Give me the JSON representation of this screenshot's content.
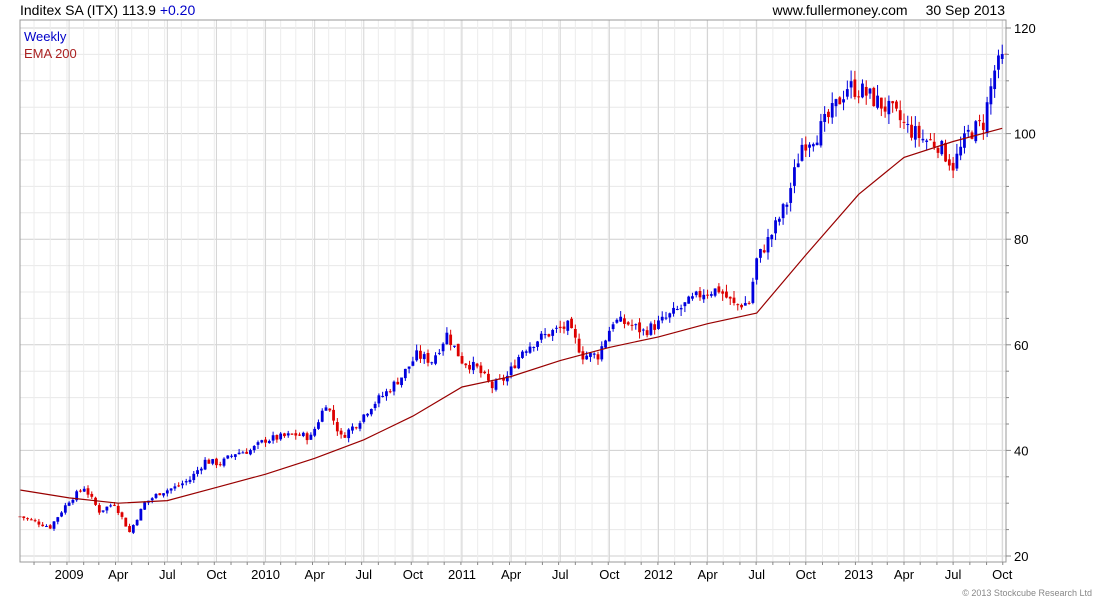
{
  "header": {
    "company": "Inditex SA (ITX)",
    "price": "113.9",
    "change": "+0.20",
    "website": "www.fullermoney.com",
    "date": "30 Sep 2013"
  },
  "footer": {
    "copyright": "© 2013 Stockcube Research Ltd"
  },
  "colors": {
    "up": "#0000dd",
    "down": "#dd0000",
    "ema": "#990000",
    "grid": "#dddddd",
    "frame": "#999999"
  },
  "chart_data": {
    "type": "line",
    "subtype": "candlestick-weekly",
    "title": "Inditex SA (ITX)",
    "xlabel": "",
    "ylabel": "",
    "ylim": [
      20,
      120
    ],
    "y_ticks": [
      20,
      40,
      60,
      80,
      100,
      120
    ],
    "y_axis_side": "right",
    "x_range": [
      "2008-10-06",
      "2013-10-07"
    ],
    "x_ticks": [
      {
        "label": "2009",
        "date": "2009-01-05"
      },
      {
        "label": "Apr",
        "date": "2009-04-06"
      },
      {
        "label": "Jul",
        "date": "2009-07-06"
      },
      {
        "label": "Oct",
        "date": "2009-10-05"
      },
      {
        "label": "2010",
        "date": "2010-01-04"
      },
      {
        "label": "Apr",
        "date": "2010-04-05"
      },
      {
        "label": "Jul",
        "date": "2010-07-05"
      },
      {
        "label": "Oct",
        "date": "2010-10-04"
      },
      {
        "label": "2011",
        "date": "2011-01-03"
      },
      {
        "label": "Apr",
        "date": "2011-04-04"
      },
      {
        "label": "Jul",
        "date": "2011-07-04"
      },
      {
        "label": "Oct",
        "date": "2011-10-03"
      },
      {
        "label": "2012",
        "date": "2012-01-02"
      },
      {
        "label": "Apr",
        "date": "2012-04-02"
      },
      {
        "label": "Jul",
        "date": "2012-07-02"
      },
      {
        "label": "Oct",
        "date": "2012-10-01"
      },
      {
        "label": "2013",
        "date": "2013-01-07"
      },
      {
        "label": "Apr",
        "date": "2013-04-01"
      },
      {
        "label": "Jul",
        "date": "2013-07-01"
      },
      {
        "label": "Oct",
        "date": "2013-09-30"
      }
    ],
    "grid": true,
    "legend": {
      "position": "top-left",
      "entries": [
        "Weekly",
        "EMA 200"
      ]
    },
    "series": [
      {
        "name": "Weekly",
        "kind": "candlestick",
        "approx_weekly_close": [
          [
            "2008-10-06",
            27.5
          ],
          [
            "2008-12-01",
            25.5
          ],
          [
            "2009-01-05",
            30.5
          ],
          [
            "2009-02-02",
            33.0
          ],
          [
            "2009-03-02",
            28.5
          ],
          [
            "2009-03-30",
            30.0
          ],
          [
            "2009-04-27",
            24.5
          ],
          [
            "2009-05-25",
            30.0
          ],
          [
            "2009-06-22",
            32.0
          ],
          [
            "2009-07-20",
            33.0
          ],
          [
            "2009-08-17",
            34.5
          ],
          [
            "2009-09-14",
            38.0
          ],
          [
            "2009-10-12",
            37.5
          ],
          [
            "2009-11-09",
            39.5
          ],
          [
            "2009-12-07",
            40.0
          ],
          [
            "2010-01-04",
            42.0
          ],
          [
            "2010-02-01",
            42.5
          ],
          [
            "2010-03-01",
            43.0
          ],
          [
            "2010-03-29",
            42.5
          ],
          [
            "2010-04-26",
            49.0
          ],
          [
            "2010-05-24",
            42.5
          ],
          [
            "2010-06-21",
            45.0
          ],
          [
            "2010-07-19",
            48.5
          ],
          [
            "2010-08-16",
            51.0
          ],
          [
            "2010-09-13",
            54.0
          ],
          [
            "2010-10-11",
            58.0
          ],
          [
            "2010-11-08",
            57.0
          ],
          [
            "2010-12-06",
            62.0
          ],
          [
            "2011-01-03",
            57.0
          ],
          [
            "2011-01-31",
            55.5
          ],
          [
            "2011-02-28",
            52.0
          ],
          [
            "2011-03-28",
            54.0
          ],
          [
            "2011-04-25",
            59.0
          ],
          [
            "2011-05-23",
            61.0
          ],
          [
            "2011-06-20",
            62.5
          ],
          [
            "2011-07-18",
            63.5
          ],
          [
            "2011-08-15",
            58.0
          ],
          [
            "2011-09-12",
            58.0
          ],
          [
            "2011-10-10",
            64.5
          ],
          [
            "2011-11-07",
            64.0
          ],
          [
            "2011-12-05",
            62.5
          ],
          [
            "2012-01-02",
            64.0
          ],
          [
            "2012-01-30",
            66.0
          ],
          [
            "2012-02-27",
            68.0
          ],
          [
            "2012-03-26",
            70.0
          ],
          [
            "2012-04-23",
            70.5
          ],
          [
            "2012-05-21",
            67.5
          ],
          [
            "2012-06-18",
            68.0
          ],
          [
            "2012-07-02",
            76.0
          ],
          [
            "2012-07-30",
            81.0
          ],
          [
            "2012-08-27",
            87.0
          ],
          [
            "2012-09-24",
            98.0
          ],
          [
            "2012-10-22",
            100.0
          ],
          [
            "2012-11-19",
            104.0
          ],
          [
            "2012-12-17",
            109.0
          ],
          [
            "2013-01-14",
            108.0
          ],
          [
            "2013-02-11",
            106.0
          ],
          [
            "2013-03-11",
            104.0
          ],
          [
            "2013-04-08",
            101.0
          ],
          [
            "2013-05-06",
            99.0
          ],
          [
            "2013-06-03",
            98.0
          ],
          [
            "2013-07-01",
            94.0
          ],
          [
            "2013-07-29",
            100.0
          ],
          [
            "2013-08-26",
            102.0
          ],
          [
            "2013-09-16",
            112.0
          ],
          [
            "2013-09-30",
            113.9
          ]
        ]
      },
      {
        "name": "EMA 200",
        "kind": "line",
        "x": [
          "2008-10-06",
          "2009-01-05",
          "2009-04-06",
          "2009-07-06",
          "2009-10-05",
          "2010-01-04",
          "2010-04-05",
          "2010-07-05",
          "2010-10-04",
          "2011-01-03",
          "2011-04-04",
          "2011-07-04",
          "2011-10-03",
          "2012-01-02",
          "2012-04-02",
          "2012-07-02",
          "2012-10-01",
          "2013-01-07",
          "2013-04-01",
          "2013-07-01",
          "2013-09-30"
        ],
        "y": [
          32.5,
          31.0,
          30.0,
          30.5,
          33.0,
          35.5,
          38.5,
          42.0,
          46.5,
          52.0,
          54.0,
          57.0,
          59.5,
          61.5,
          64.0,
          66.0,
          77.0,
          88.5,
          95.5,
          98.5,
          101.0
        ]
      }
    ]
  }
}
